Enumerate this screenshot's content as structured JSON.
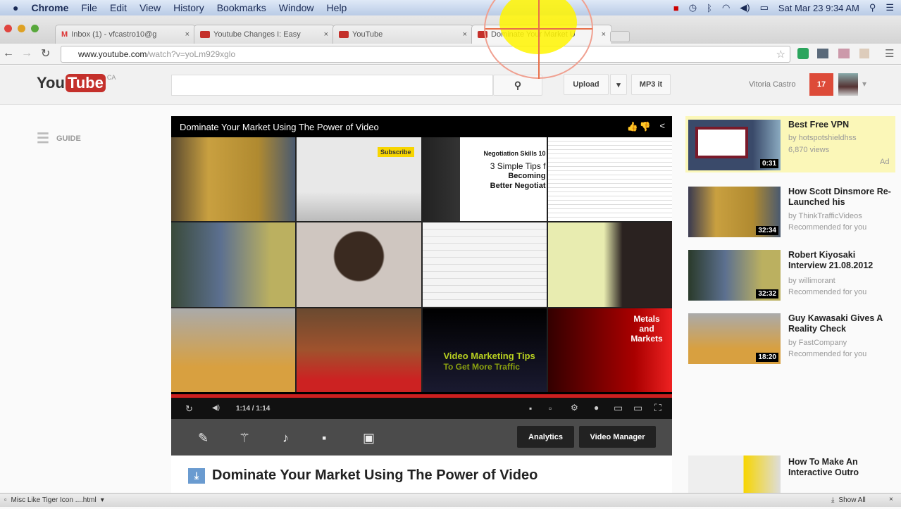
{
  "menubar": {
    "apple": "",
    "items": [
      "Chrome",
      "File",
      "Edit",
      "View",
      "History",
      "Bookmarks",
      "Window",
      "Help"
    ],
    "clock": "Sat Mar 23  9:34 AM"
  },
  "tabs": [
    {
      "label": "Inbox (1) - vfcastro10@g"
    },
    {
      "label": "Youtube Changes I: Easy"
    },
    {
      "label": "YouTube"
    },
    {
      "label": "Dominate Your Market U"
    }
  ],
  "address": {
    "host": "www.youtube.com",
    "path": "/watch?v=yoLm929xglo"
  },
  "youtube": {
    "logo_you": "You",
    "logo_tube": "Tube",
    "region": "CA",
    "search_placeholder": "",
    "upload": "Upload",
    "mp3": "MP3 it",
    "user": "Vitoria Castro",
    "notifications": "17",
    "guide": "GUIDE"
  },
  "player": {
    "title": "Dominate Your Market Using The Power of Video",
    "time": "1:14 / 1:14",
    "progress": 1.0,
    "cells": {
      "subscribe": "Subscribe",
      "neg1": "Negotiation Skills 10",
      "neg2": "3 Simple Tips f",
      "neg3": "Becoming",
      "neg4": "Better Negotiat",
      "vm1": "Video Marketing Tips",
      "vm2": "To Get More Traffic",
      "metals": "Metals and Markets"
    }
  },
  "tools": {
    "analytics": "Analytics",
    "video_manager": "Video Manager"
  },
  "video_title": "Dominate Your Market Using The Power of Video",
  "sidebar": [
    {
      "title": "Best Free VPN",
      "by": "by hotspotshieldhss",
      "meta": "6,870 views",
      "duration": "0:31",
      "badge": "Ad"
    },
    {
      "title": "How Scott Dinsmore Re-Launched his",
      "by": "by ThinkTrafficVideos",
      "meta": "Recommended for you",
      "duration": "32:34"
    },
    {
      "title": "Robert Kiyosaki Interview 21.08.2012",
      "by": "by willimorant",
      "meta": "Recommended for you",
      "duration": "32:32"
    },
    {
      "title": "Guy Kawasaki Gives A Reality Check",
      "by": "by FastCompany",
      "meta": "Recommended for you",
      "duration": "18:20"
    },
    {
      "title": "How To Make An Interactive Outro",
      "by": "",
      "meta": "",
      "duration": ""
    }
  ],
  "downloads": {
    "file": "Misc Like Tiger Icon ....html",
    "show_all": "Show All"
  },
  "colors": {
    "youtube_red": "#c4302b",
    "ad_bg": "#fbf7b8",
    "progress": "#cc1f1f"
  }
}
